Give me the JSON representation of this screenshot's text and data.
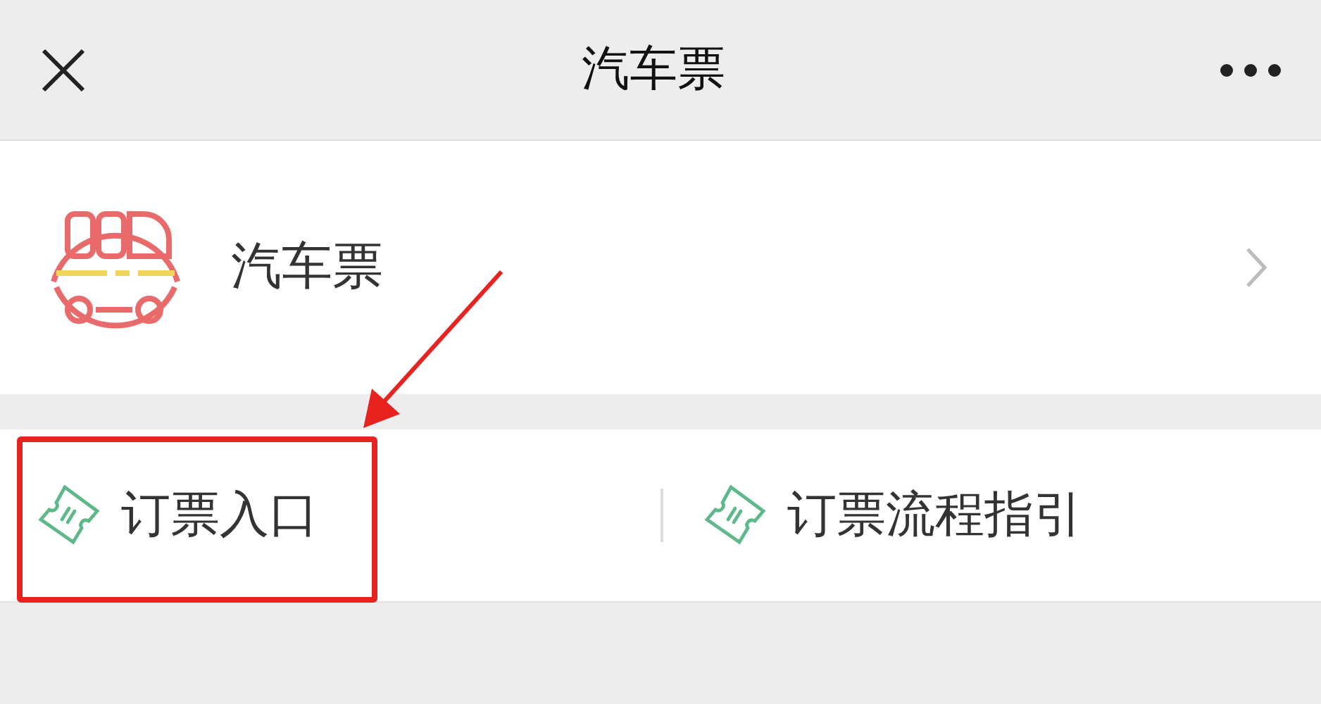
{
  "header": {
    "title": "汽车票"
  },
  "service": {
    "name": "汽车票"
  },
  "menu": [
    {
      "label": "订票入口",
      "highlighted": true
    },
    {
      "label": "订票流程指引",
      "highlighted": false
    }
  ]
}
